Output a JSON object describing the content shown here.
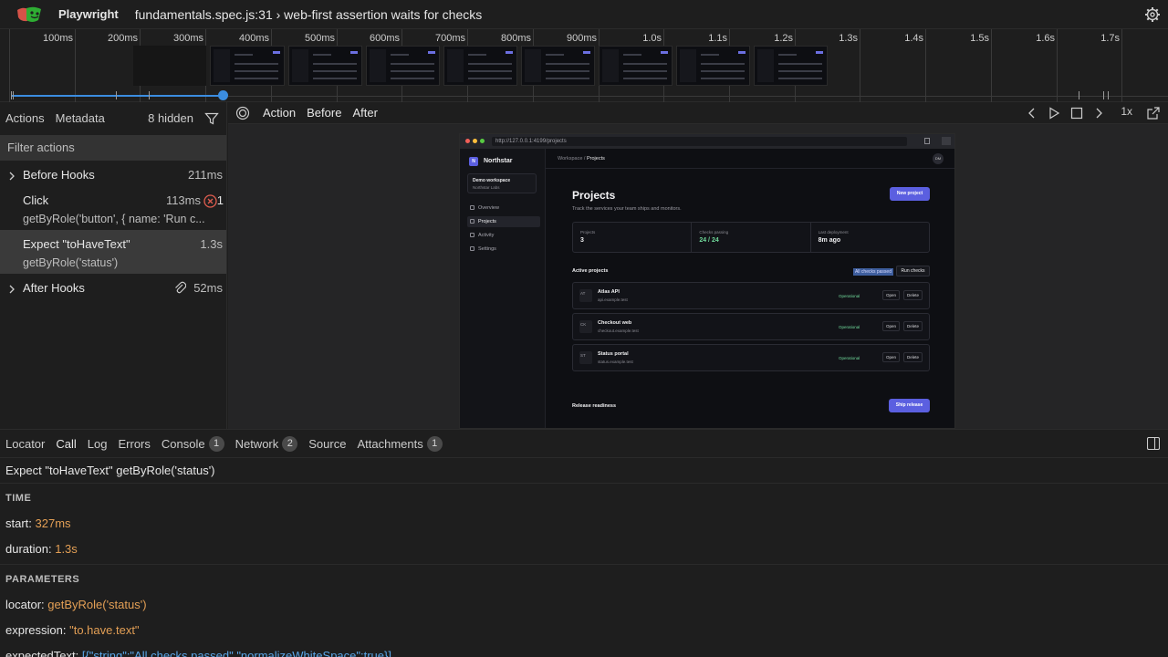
{
  "header": {
    "app_name": "Playwright",
    "test_title": "fundamentals.spec.js:31 › web-first assertion waits for checks",
    "logo_icon": "playwright-logo-icon",
    "settings_icon": "gear-icon"
  },
  "timeline": {
    "ticks": [
      "100ms",
      "200ms",
      "300ms",
      "400ms",
      "500ms",
      "600ms",
      "700ms",
      "800ms",
      "900ms",
      "1.0s",
      "1.1s",
      "1.2s",
      "1.3s",
      "1.4s",
      "1.5s",
      "1.6s",
      "1.7s"
    ],
    "accent": "#3b8de0"
  },
  "actions_panel": {
    "tabs": [
      "Actions",
      "Metadata"
    ],
    "hidden_label": "8 hidden",
    "filter_placeholder": "Filter actions",
    "items": [
      {
        "title": "Before Hooks",
        "time": "211ms"
      },
      {
        "title": "Click",
        "time": "113ms",
        "error_count": "1",
        "detail": "getByRole('button', { name: 'Run c..."
      },
      {
        "title": "Expect \"toHaveText\"",
        "time": "1.3s",
        "detail": "getByRole('status')"
      },
      {
        "title": "After Hooks",
        "time": "52ms"
      }
    ]
  },
  "snapshot": {
    "tabs": [
      "Action",
      "Before",
      "After"
    ],
    "speed": "1x",
    "browser": {
      "url": "http://127.0.0.1:4199/projects",
      "brand": "Northstar",
      "brand_mark": "N",
      "workspace_name": "Demo workspace",
      "workspace_org": "Northstar Labs",
      "nav": [
        "Overview",
        "Projects",
        "Activity",
        "Settings"
      ],
      "breadcrumb_parent": "Workspace /",
      "breadcrumb_current": "Projects",
      "avatar": "DM",
      "page_title": "Projects",
      "page_subtitle": "Track the services your team ships and monitors.",
      "new_project": "New project",
      "stats": [
        {
          "label": "Projects",
          "value": "3"
        },
        {
          "label": "Checks passing",
          "value": "24 / 24"
        },
        {
          "label": "Last deployment",
          "value": "8m ago"
        }
      ],
      "active_projects_title": "Active projects",
      "status_text": "All checks passed",
      "run_checks": "Run checks",
      "projects": [
        {
          "initials": "AT",
          "name": "Atlas API",
          "domain": "api.example.test",
          "status": "Operational"
        },
        {
          "initials": "CK",
          "name": "Checkout web",
          "domain": "checkout.example.test",
          "status": "Operational"
        },
        {
          "initials": "ST",
          "name": "Status portal",
          "domain": "status.example.test",
          "status": "Operational"
        }
      ],
      "open_label": "Open",
      "delete_label": "Delete",
      "release_title": "Release readiness",
      "ship_release": "Ship release",
      "accent": "#5b5fe0"
    }
  },
  "details": {
    "tabs": [
      {
        "label": "Locator"
      },
      {
        "label": "Call"
      },
      {
        "label": "Log"
      },
      {
        "label": "Errors"
      },
      {
        "label": "Console",
        "badge": "1"
      },
      {
        "label": "Network",
        "badge": "2"
      },
      {
        "label": "Source"
      },
      {
        "label": "Attachments",
        "badge": "1"
      }
    ],
    "call_title": "Expect \"toHaveText\" getByRole('status')",
    "time_section": "TIME",
    "start_key": "start:",
    "start_value": "327ms",
    "duration_key": "duration:",
    "duration_value": "1.3s",
    "params_section": "PARAMETERS",
    "locator_key": "locator:",
    "locator_value": "getByRole('status')",
    "expression_key": "expression:",
    "expression_value": "\"to.have.text\"",
    "expected_key": "expectedText:",
    "expected_value": "[{\"string\":\"All checks passed\",\"normalizeWhiteSpace\":true}]"
  }
}
